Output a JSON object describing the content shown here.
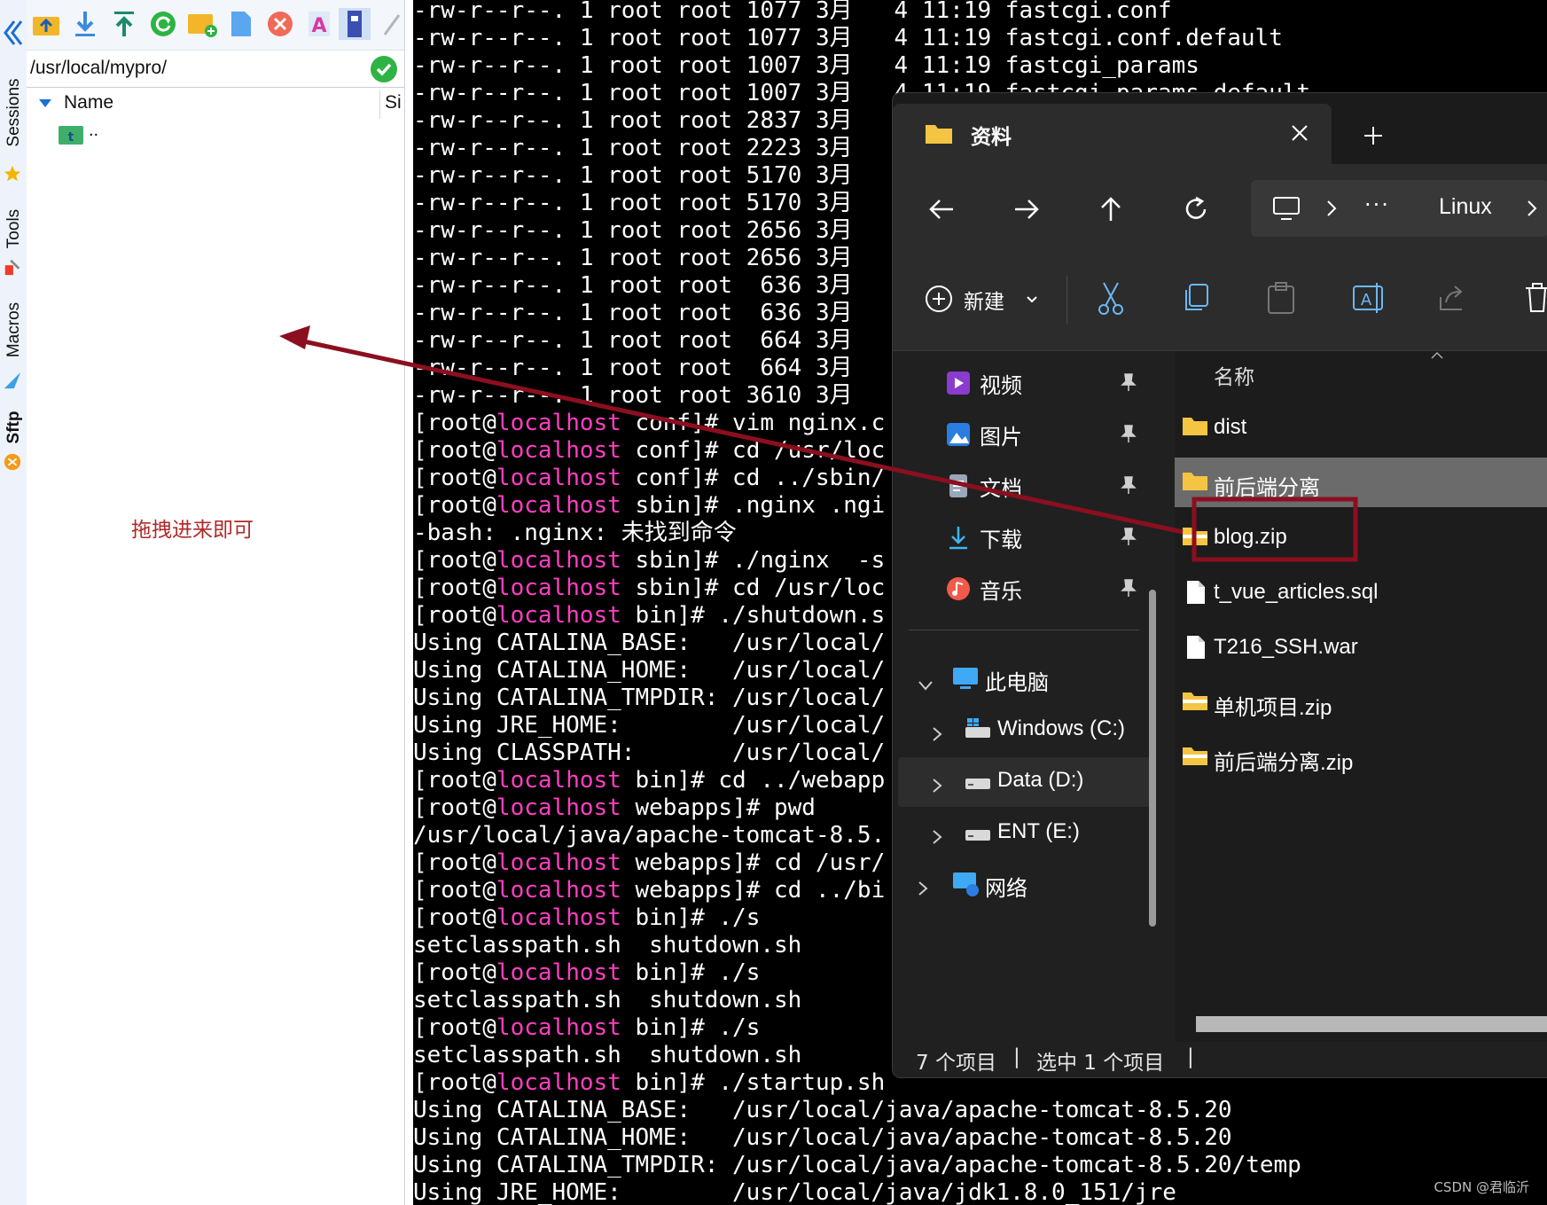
{
  "left_tabs": {
    "sessions": "Sessions",
    "tools": "Tools",
    "macros": "Macros",
    "sftp": "Sftp"
  },
  "sftp": {
    "toolbar_icons": [
      "upload-folder-icon",
      "download-icon",
      "upload-icon",
      "refresh-icon",
      "new-folder-icon",
      "new-file-icon",
      "delete-icon",
      "rename-icon",
      "permissions-icon",
      "edit-icon"
    ],
    "path": "/usr/local/mypro/",
    "columns": {
      "name": "Name",
      "size": "Si"
    },
    "parent_entry": "..",
    "hint": "拖拽进来即可"
  },
  "terminal": {
    "lines": [
      [
        "-rw-r--r--. 1 root root 1077 3月   4 11:19 fastcgi.conf",
        ""
      ],
      [
        "-rw-r--r--. 1 root root 1077 3月   4 11:19 fastcgi.conf.default",
        ""
      ],
      [
        "-rw-r--r--. 1 root root 1007 3月   4 11:19 fastcgi_params",
        ""
      ],
      [
        "-rw-r--r--. 1 root root 1007 3月   4 11:19 fastcgi_params.default",
        ""
      ],
      [
        "-rw-r--r--. 1 root root 2837 3月",
        ""
      ],
      [
        "-rw-r--r--. 1 root root 2223 3月",
        ""
      ],
      [
        "-rw-r--r--. 1 root root 5170 3月",
        ""
      ],
      [
        "-rw-r--r--. 1 root root 5170 3月",
        ""
      ],
      [
        "-rw-r--r--. 1 root root 2656 3月",
        ""
      ],
      [
        "-rw-r--r--. 1 root root 2656 3月",
        ""
      ],
      [
        "-rw-r--r--. 1 root root  636 3月",
        ""
      ],
      [
        "-rw-r--r--. 1 root root  636 3月",
        ""
      ],
      [
        "-rw-r--r--. 1 root root  664 3月",
        ""
      ],
      [
        "-rw-r--r--. 1 root root  664 3月",
        ""
      ],
      [
        "-rw-r--r--. 1 root root 3610 3月",
        ""
      ],
      [
        "[root@",
        "localhost",
        " conf]# vim nginx.c"
      ],
      [
        "[root@",
        "localhost",
        " conf]# cd /usr/loc"
      ],
      [
        "[root@",
        "localhost",
        " conf]# cd ../sbin/"
      ],
      [
        "[root@",
        "localhost",
        " sbin]# .nginx .ngi"
      ],
      [
        "-bash: .nginx: 未找到命令",
        ""
      ],
      [
        "[root@",
        "localhost",
        " sbin]# ./nginx  -s"
      ],
      [
        "[root@",
        "localhost",
        " sbin]# cd /usr/loc"
      ],
      [
        "[root@",
        "localhost",
        " bin]# ./shutdown.s"
      ],
      [
        "Using CATALINA_BASE:   /usr/local/",
        ""
      ],
      [
        "Using CATALINA_HOME:   /usr/local/",
        ""
      ],
      [
        "Using CATALINA_TMPDIR: /usr/local/",
        ""
      ],
      [
        "Using JRE_HOME:        /usr/local/",
        ""
      ],
      [
        "Using CLASSPATH:       /usr/local/",
        ""
      ],
      [
        "[root@",
        "localhost",
        " bin]# cd ../webapp"
      ],
      [
        "[root@",
        "localhost",
        " webapps]# pwd"
      ],
      [
        "/usr/local/java/apache-tomcat-8.5.",
        ""
      ],
      [
        "[root@",
        "localhost",
        " webapps]# cd /usr/"
      ],
      [
        "[root@",
        "localhost",
        " webapps]# cd ../bi"
      ],
      [
        "[root@",
        "localhost",
        " bin]# ./s"
      ],
      [
        "setclasspath.sh  shutdown.sh",
        ""
      ],
      [
        "[root@",
        "localhost",
        " bin]# ./s"
      ],
      [
        "setclasspath.sh  shutdown.sh",
        ""
      ],
      [
        "[root@",
        "localhost",
        " bin]# ./s"
      ],
      [
        "setclasspath.sh  shutdown.sh",
        ""
      ],
      [
        "[root@",
        "localhost",
        " bin]# ./startup.sh"
      ],
      [
        "Using CATALINA_BASE:   /usr/local/java/apache-tomcat-8.5.20",
        ""
      ],
      [
        "Using CATALINA_HOME:   /usr/local/java/apache-tomcat-8.5.20",
        ""
      ],
      [
        "Using CATALINA_TMPDIR: /usr/local/java/apache-tomcat-8.5.20/temp",
        ""
      ],
      [
        "Using JRE_HOME:        /usr/local/java/jdk1.8.0_151/jre",
        ""
      ]
    ]
  },
  "explorer": {
    "tab_title": "资料",
    "breadcrumb_last": "Linux",
    "new_button": "新建",
    "nav_quick": [
      {
        "label": "视频",
        "icon": "video-icon"
      },
      {
        "label": "图片",
        "icon": "pictures-icon"
      },
      {
        "label": "文档",
        "icon": "documents-icon"
      },
      {
        "label": "下载",
        "icon": "downloads-icon"
      },
      {
        "label": "音乐",
        "icon": "music-icon"
      }
    ],
    "this_pc": "此电脑",
    "drives": [
      "Windows (C:)",
      "Data (D:)",
      "ENT (E:)"
    ],
    "network": "网络",
    "column_name": "名称",
    "files": [
      {
        "name": "dist",
        "type": "folder"
      },
      {
        "name": "前后端分离",
        "type": "folder"
      },
      {
        "name": "blog.zip",
        "type": "zip"
      },
      {
        "name": "t_vue_articles.sql",
        "type": "file"
      },
      {
        "name": "T216_SSH.war",
        "type": "file"
      },
      {
        "name": "单机项目.zip",
        "type": "zip"
      },
      {
        "name": "前后端分离.zip",
        "type": "zip"
      }
    ],
    "status_count": "7 个项目",
    "status_selected": "选中 1 个项目"
  },
  "watermark": "CSDN @君临沂",
  "colors": {
    "annotation": "#8b0f1f",
    "terminal_host": "#ff3ec1",
    "explorer_bg": "#202020"
  }
}
